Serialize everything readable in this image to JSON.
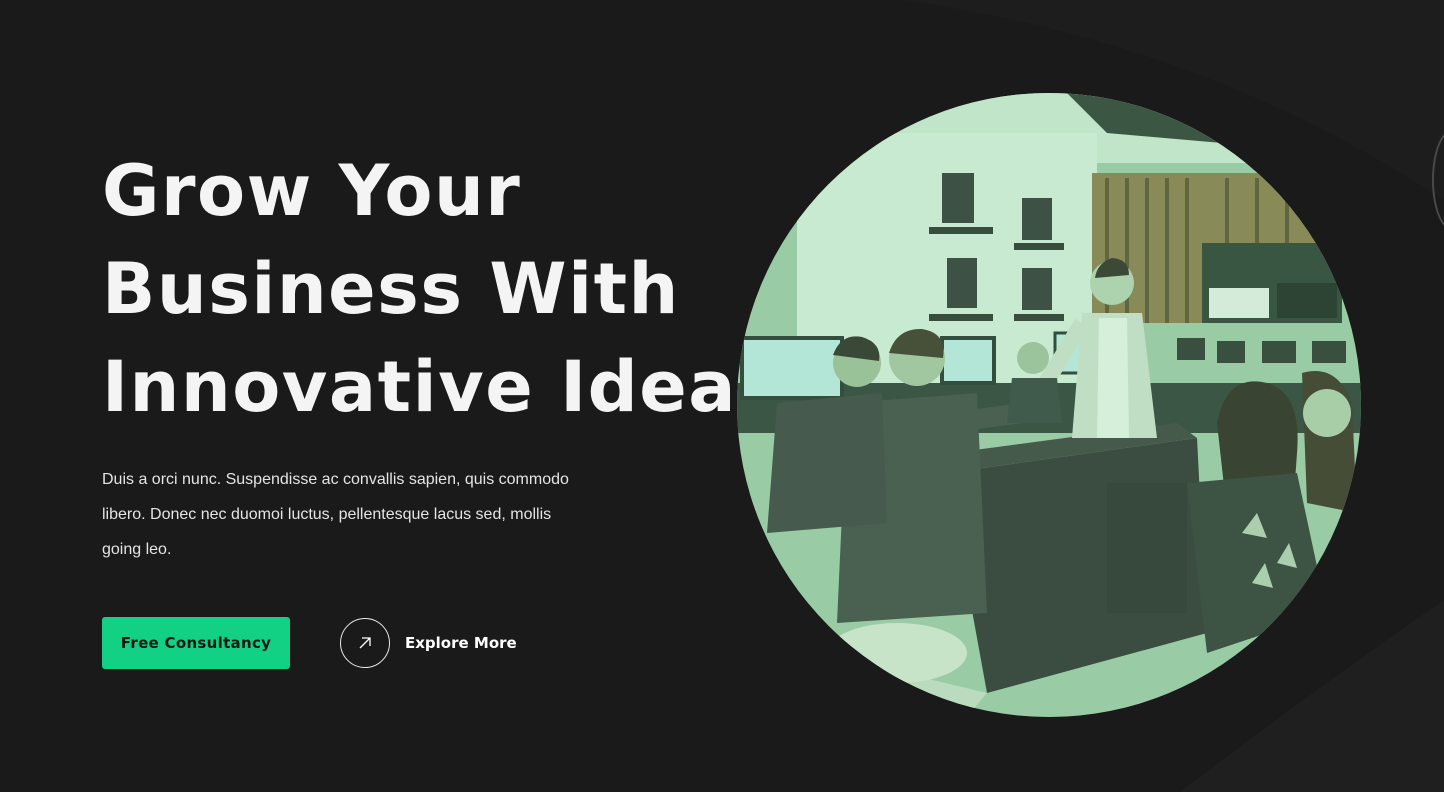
{
  "hero": {
    "headline_line1": "Grow Your",
    "headline_line2": "Business With",
    "headline_line3": "Innovative Ideas.",
    "description": "Duis a orci nunc. Suspendisse ac convallis sapien, quis commodo libero. Donec nec duomoi luctus, pellentesque lacus sed, mollis going leo.",
    "cta_primary_label": "Free Consultancy",
    "cta_secondary_label": "Explore More",
    "cta_secondary_icon": "arrow-up-right-icon",
    "image_subject": "office-team-photo"
  },
  "colors": {
    "background": "#1a1a1b",
    "accent": "#12d185",
    "text": "#f4f4f4",
    "photo_tint": "#b8e8c4"
  }
}
